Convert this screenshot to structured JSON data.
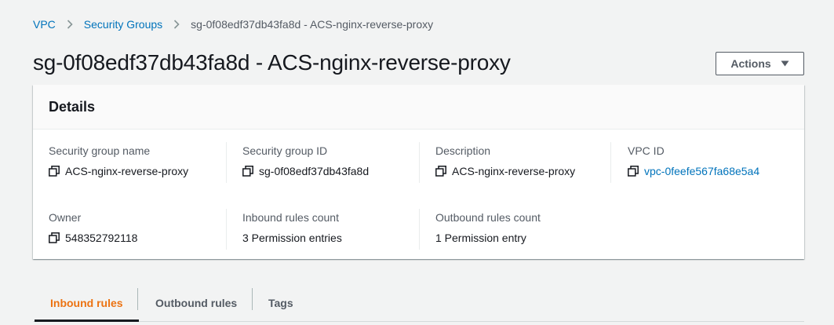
{
  "breadcrumb": {
    "items": [
      {
        "label": "VPC"
      },
      {
        "label": "Security Groups"
      }
    ],
    "current": "sg-0f08edf37db43fa8d - ACS-nginx-reverse-proxy"
  },
  "page": {
    "title": "sg-0f08edf37db43fa8d - ACS-nginx-reverse-proxy",
    "actions_label": "Actions"
  },
  "details": {
    "heading": "Details",
    "fields": {
      "sg_name": {
        "label": "Security group name",
        "value": "ACS-nginx-reverse-proxy"
      },
      "sg_id": {
        "label": "Security group ID",
        "value": "sg-0f08edf37db43fa8d"
      },
      "description": {
        "label": "Description",
        "value": "ACS-nginx-reverse-proxy"
      },
      "vpc_id": {
        "label": "VPC ID",
        "value": "vpc-0feefe567fa68e5a4"
      },
      "owner": {
        "label": "Owner",
        "value": "548352792118"
      },
      "inbound_count": {
        "label": "Inbound rules count",
        "value": "3 Permission entries"
      },
      "outbound_count": {
        "label": "Outbound rules count",
        "value": "1 Permission entry"
      }
    }
  },
  "tabs": [
    {
      "label": "Inbound rules",
      "active": true
    },
    {
      "label": "Outbound rules",
      "active": false
    },
    {
      "label": "Tags",
      "active": false
    }
  ],
  "colors": {
    "link": "#0073bb",
    "active_tab": "#ec7211",
    "background": "#f2f3f3"
  },
  "icons": {
    "copy": "copy-icon",
    "breadcrumb_separator": "chevron-right-icon",
    "actions_caret": "caret-down-icon"
  }
}
